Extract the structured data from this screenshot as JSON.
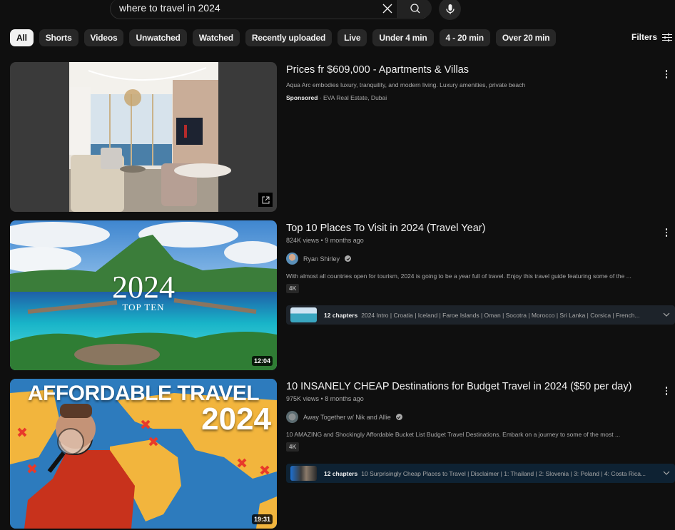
{
  "search": {
    "query": "where to travel in 2024",
    "clear_icon": "close-icon",
    "search_icon": "search-icon",
    "mic_icon": "microphone-icon"
  },
  "chips": [
    {
      "label": "All",
      "active": true
    },
    {
      "label": "Shorts"
    },
    {
      "label": "Videos"
    },
    {
      "label": "Unwatched"
    },
    {
      "label": "Watched"
    },
    {
      "label": "Recently uploaded"
    },
    {
      "label": "Live"
    },
    {
      "label": "Under 4 min"
    },
    {
      "label": "4 - 20 min"
    },
    {
      "label": "Over 20 min"
    }
  ],
  "filters": {
    "label": "Filters",
    "icon": "sliders-icon"
  },
  "ad": {
    "title": "Prices fr $609,000 - Apartments & Villas",
    "description": "Aqua Arc embodies luxury, tranquility, and modern living. Luxury amenities, private beach",
    "sponsored_label": "Sponsored",
    "separator": "·",
    "advertiser": "EVA Real Estate, Dubai",
    "open_icon": "external-link-icon"
  },
  "videos": [
    {
      "title": "Top 10 Places To Visit in 2024 (Travel Year)",
      "views": "824K views",
      "age": "9 months ago",
      "channel": "Ryan Shirley",
      "description": "With almost all countries open for tourism, 2024 is going to be a year full of travel. Enjoy this travel guide featuring some of the ...",
      "badge": "4K",
      "duration": "12:04",
      "thumb_text_main": "2024",
      "thumb_text_sub": "TOP TEN",
      "chapters_count": "12 chapters",
      "chapters_list": "2024 Intro | Croatia | Iceland | Faroe Islands | Oman | Socotra | Morocco | Sri Lanka | Corsica | French..."
    },
    {
      "title": "10 INSANELY CHEAP Destinations for Budget Travel in 2024 ($50 per day)",
      "views": "975K views",
      "age": "8 months ago",
      "channel": "Away Together w/ Nik and Allie",
      "description": "10 AMAZING and Shockingly Affordable Bucket List Budget Travel Destinations. Embark on a journey to some of the most ...",
      "badge": "4K",
      "duration": "19:31",
      "thumb_text_main": "AFFORDABLE TRAVEL",
      "thumb_text_sub": "2024",
      "chapters_count": "12 chapters",
      "chapters_list": "10 Surprisingly Cheap Places to Travel | Disclaimer | 1: Thailand | 2: Slovenia | 3: Poland | 4: Costa Rica..."
    }
  ],
  "meta_separator": "•"
}
